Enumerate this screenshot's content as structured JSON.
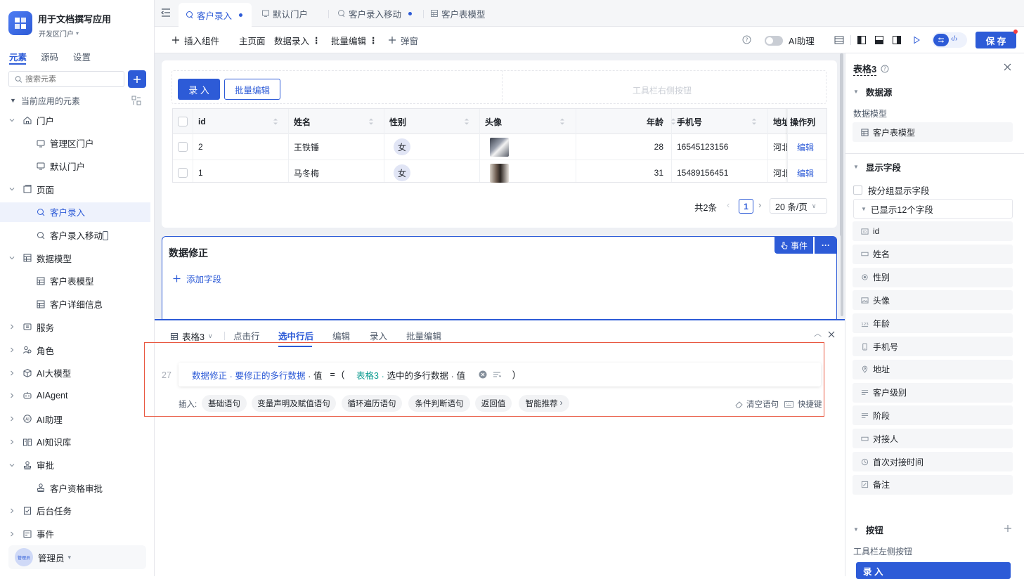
{
  "app": {
    "name": "用于文档撰写应用",
    "portal": "开发区门户"
  },
  "side_tabs": [
    "元素",
    "源码",
    "设置"
  ],
  "search": {
    "placeholder": "搜索元素"
  },
  "tree_header": "当前应用的元素",
  "tree": [
    {
      "label": "门户",
      "level": 0,
      "icon": "home-icon",
      "expanded": true
    },
    {
      "label": "管理区门户",
      "level": 1,
      "icon": "portal-icon"
    },
    {
      "label": "默认门户",
      "level": 1,
      "icon": "portal-icon"
    },
    {
      "label": "页面",
      "level": 0,
      "icon": "page-icon",
      "expanded": true
    },
    {
      "label": "客户录入",
      "level": 1,
      "icon": "page-item-icon",
      "selected": true
    },
    {
      "label": "客户录入移动",
      "level": 1,
      "icon": "page-item-icon",
      "mobile": true
    },
    {
      "label": "数据模型",
      "level": 0,
      "icon": "table-icon",
      "expanded": true
    },
    {
      "label": "客户表模型",
      "level": 1,
      "icon": "table-icon"
    },
    {
      "label": "客户详细信息",
      "level": 1,
      "icon": "table-icon"
    },
    {
      "label": "服务",
      "level": 0,
      "icon": "service-icon"
    },
    {
      "label": "角色",
      "level": 0,
      "icon": "role-icon"
    },
    {
      "label": "AI大模型",
      "level": 0,
      "icon": "cube-icon"
    },
    {
      "label": "AIAgent",
      "level": 0,
      "icon": "robot-icon"
    },
    {
      "label": "AI助理",
      "level": 0,
      "icon": "ai-icon"
    },
    {
      "label": "AI知识库",
      "level": 0,
      "icon": "book-icon"
    },
    {
      "label": "审批",
      "level": 0,
      "icon": "stamp-icon",
      "expanded": true
    },
    {
      "label": "客户资格审批",
      "level": 1,
      "icon": "stamp-icon"
    },
    {
      "label": "后台任务",
      "level": 0,
      "icon": "task-icon"
    },
    {
      "label": "事件",
      "level": 0,
      "icon": "event-icon"
    }
  ],
  "user": {
    "name": "管理员",
    "avatar_text": "管理员"
  },
  "tabs": [
    {
      "label": "客户录入",
      "active": true,
      "dot": true
    },
    {
      "label": "默认门户",
      "active": false,
      "dot": false
    },
    {
      "label": "客户录入移动",
      "active": false,
      "dot": true
    },
    {
      "label": "客户表模型",
      "active": false,
      "dot": false
    }
  ],
  "toolbar": {
    "insert": "插入组件",
    "main_page": "主页面",
    "data_entry": "数据录入",
    "batch_edit": "批量编辑",
    "popup": "弹窗",
    "ai_assist": "AI助理",
    "save": "保 存"
  },
  "table_card": {
    "btn_entry": "录 入",
    "btn_batch": "批量编辑",
    "right_slot": "工具栏右侧按钮",
    "columns": [
      "id",
      "姓名",
      "性别",
      "头像",
      "年龄",
      "手机号",
      "地址",
      "操作列"
    ],
    "rows": [
      {
        "id": "2",
        "name": "王铁锤",
        "gender": "女",
        "age": "28",
        "phone": "16545123156",
        "addr": "河北",
        "action": "编辑"
      },
      {
        "id": "1",
        "name": "马冬梅",
        "gender": "女",
        "age": "31",
        "phone": "15489156451",
        "addr": "河北",
        "action": "编辑"
      }
    ],
    "total": "共2条",
    "page": "1",
    "page_size": "20 条/页"
  },
  "form_card": {
    "title": "数据修正",
    "add_field": "添加字段",
    "event_btn": "事件",
    "more": "···"
  },
  "bottom": {
    "table_selector": "表格3",
    "tabs": [
      "点击行",
      "选中行后",
      "编辑",
      "录入",
      "批量编辑"
    ],
    "active_tab": "选中行后",
    "line_no": "27",
    "code": {
      "target": "数据修正",
      "dot1": ".",
      "prop1": "要修正的多行数据",
      "dot2": ".",
      "val1": "值",
      "eq": "=",
      "lparen": "(",
      "src": "表格3",
      "dot3": ".",
      "prop2": "选中的多行数据",
      "dot4": ".",
      "val2": "值",
      "rparen": ")"
    },
    "insert_label": "插入:",
    "chips": [
      "基础语句",
      "变量声明及赋值语句",
      "循环遍历语句",
      "条件判断语句",
      "返回值",
      "智能推荐"
    ],
    "clear": "清空语句",
    "shortcut": "快捷键"
  },
  "right": {
    "title": "表格3",
    "sec_datasource": "数据源",
    "model_label": "数据模型",
    "model_value": "客户表模型",
    "sec_fields": "显示字段",
    "group_fields": "按分组显示字段",
    "shown_count": "已显示12个字段",
    "fields": [
      {
        "label": "id",
        "icon": "id-icon"
      },
      {
        "label": "姓名",
        "icon": "text-icon"
      },
      {
        "label": "性别",
        "icon": "radio-icon"
      },
      {
        "label": "头像",
        "icon": "image-icon"
      },
      {
        "label": "年龄",
        "icon": "number-icon"
      },
      {
        "label": "手机号",
        "icon": "phone-icon"
      },
      {
        "label": "地址",
        "icon": "location-icon"
      },
      {
        "label": "客户级别",
        "icon": "select-icon"
      },
      {
        "label": "阶段",
        "icon": "select-icon"
      },
      {
        "label": "对接人",
        "icon": "text-icon"
      },
      {
        "label": "首次对接时间",
        "icon": "time-icon"
      },
      {
        "label": "备注",
        "icon": "note-icon"
      }
    ],
    "sec_buttons": "按钮",
    "toolbar_left": "工具栏左侧按钮",
    "entry_btn": "录 入"
  }
}
